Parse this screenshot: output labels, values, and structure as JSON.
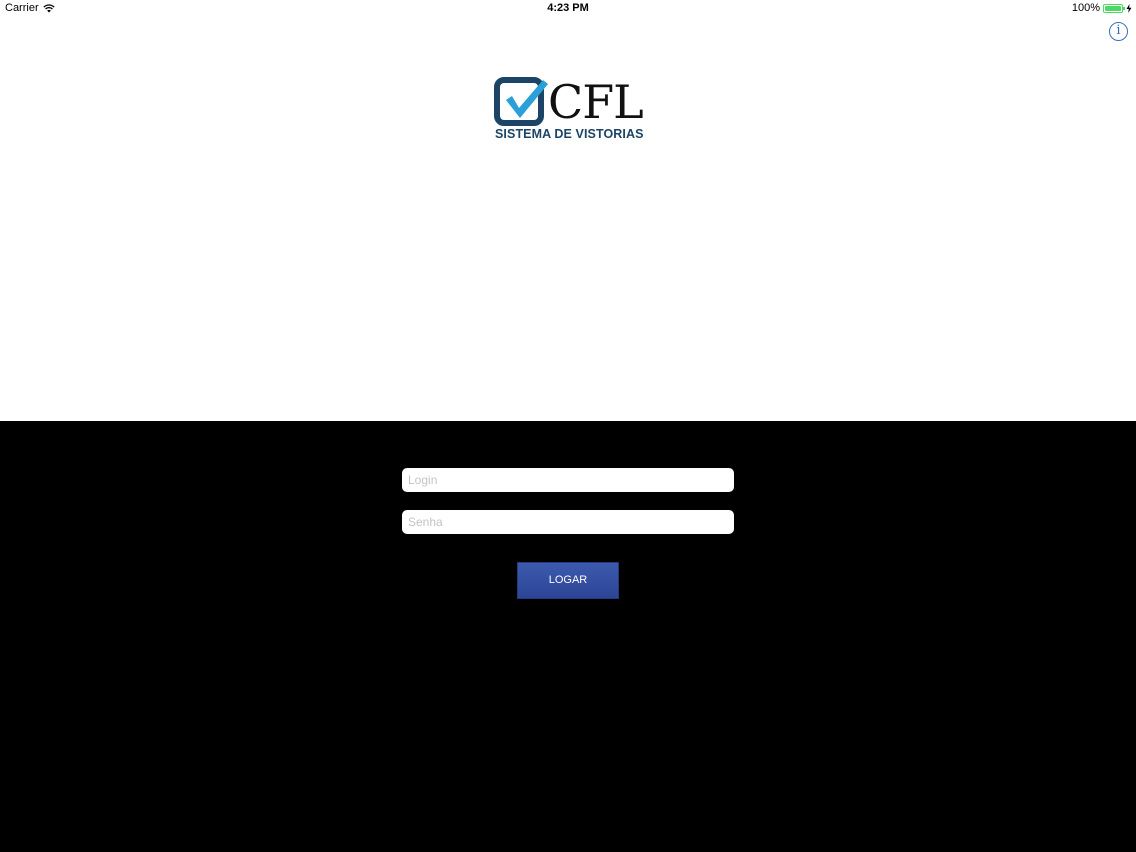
{
  "status_bar": {
    "carrier": "Carrier",
    "time": "4:23 PM",
    "battery_percent": "100%",
    "battery_level": 1.0,
    "wifi_icon": "wifi-icon",
    "charging_icon": "bolt-icon"
  },
  "header": {
    "info_icon": "info-icon",
    "info_glyph": "i"
  },
  "logo": {
    "wordmark": "CFL",
    "subtitle": "SISTEMA DE VISTORIAS",
    "checkbox_color": "#1c4466",
    "check_color": "#2aa0d8"
  },
  "form": {
    "login_placeholder": "Login",
    "password_placeholder": "Senha",
    "submit_label": "LOGAR"
  },
  "colors": {
    "panel_background": "#000000",
    "button_color": "#344fa3",
    "accent": "#3a6fb8"
  }
}
